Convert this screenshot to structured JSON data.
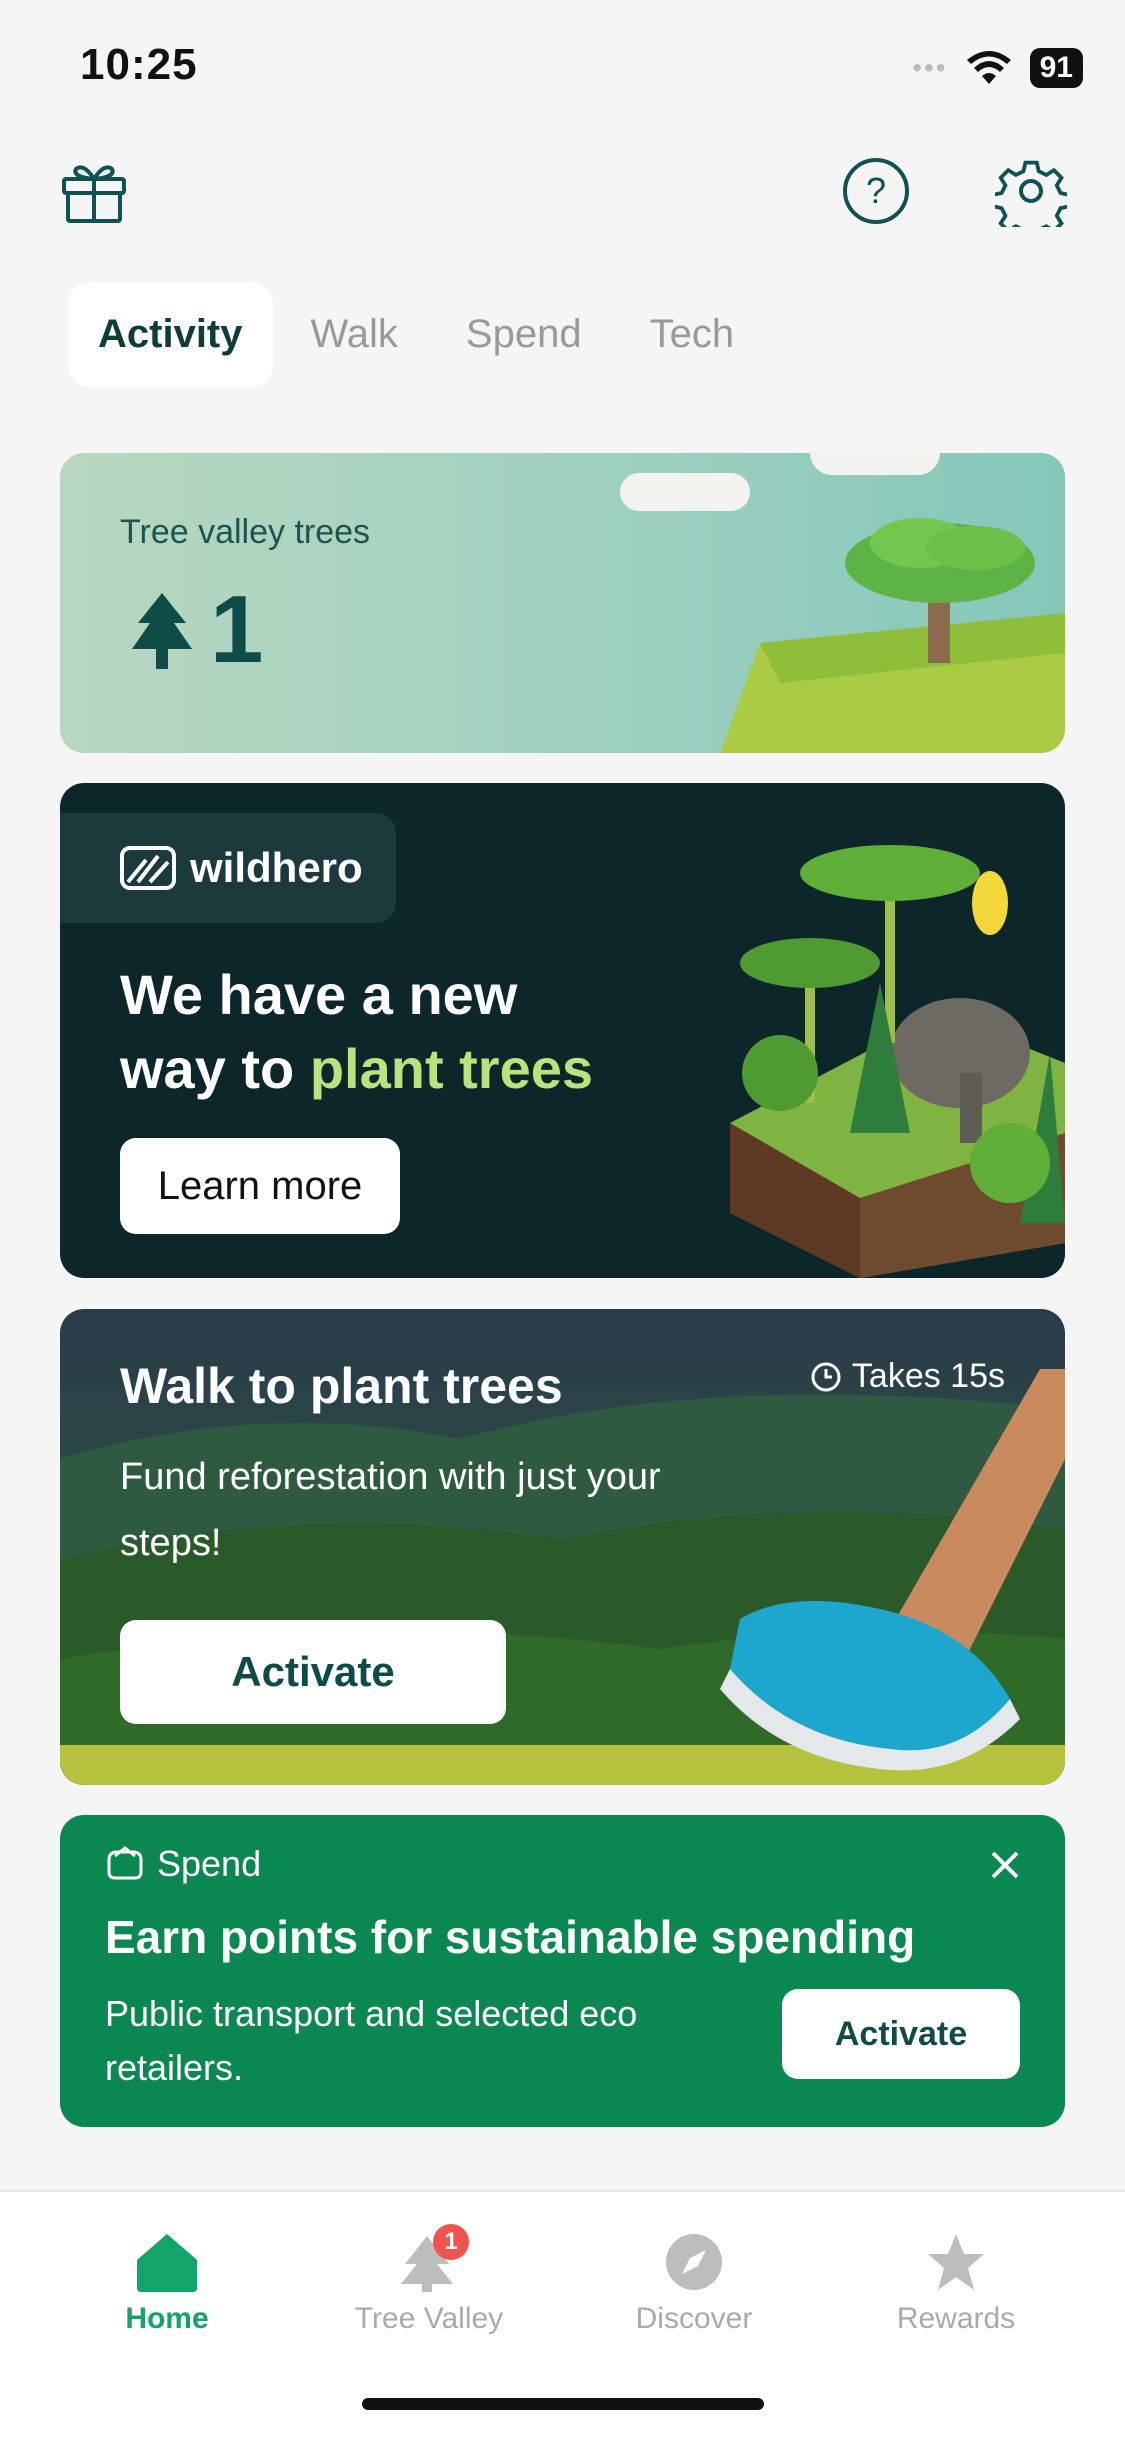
{
  "status_bar": {
    "time": "10:25",
    "battery": "91"
  },
  "tabs": [
    {
      "label": "Activity",
      "active": true
    },
    {
      "label": "Walk",
      "active": false
    },
    {
      "label": "Spend",
      "active": false
    },
    {
      "label": "Tech",
      "active": false
    }
  ],
  "tree_card": {
    "label": "Tree valley trees",
    "count": "1"
  },
  "wildhero_card": {
    "brand": "wildhero",
    "headline_part1": "We have a new",
    "headline_part2": "way to ",
    "headline_highlight": "plant trees",
    "button": "Learn more"
  },
  "walk_card": {
    "title": "Walk to plant trees",
    "duration": "Takes 15s",
    "description": "Fund reforestation with just your steps!",
    "button": "Activate"
  },
  "spend_card": {
    "tag": "Spend",
    "title": "Earn points for sustainable spending",
    "description": "Public transport and selected eco retailers.",
    "button": "Activate"
  },
  "bottom_nav": [
    {
      "label": "Home",
      "active": true
    },
    {
      "label": "Tree Valley",
      "badge": "1"
    },
    {
      "label": "Discover"
    },
    {
      "label": "Rewards"
    }
  ],
  "colors": {
    "primary": "#0b8852",
    "dark_card": "#0d2629",
    "highlight": "#b9e37c"
  }
}
